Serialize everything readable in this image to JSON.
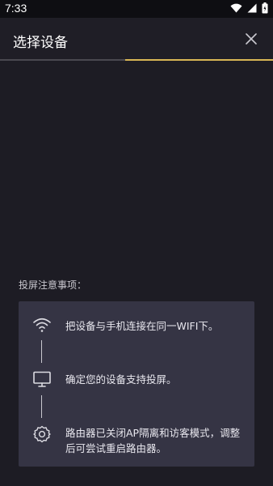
{
  "status_bar": {
    "time": "7:33"
  },
  "header": {
    "title": "选择设备"
  },
  "notes": {
    "label": "投屏注意事项：",
    "steps": [
      {
        "icon": "wifi-icon",
        "text": "把设备与手机连接在同一WIFI下。"
      },
      {
        "icon": "monitor-icon",
        "text": "确定您的设备支持投屏。"
      },
      {
        "icon": "gear-icon",
        "text": "路由器已关闭AP隔离和访客模式，调整后可尝试重启路由器。"
      }
    ]
  },
  "colors": {
    "accent": "#d8b655",
    "background": "#1d1c24",
    "card": "#353444"
  }
}
